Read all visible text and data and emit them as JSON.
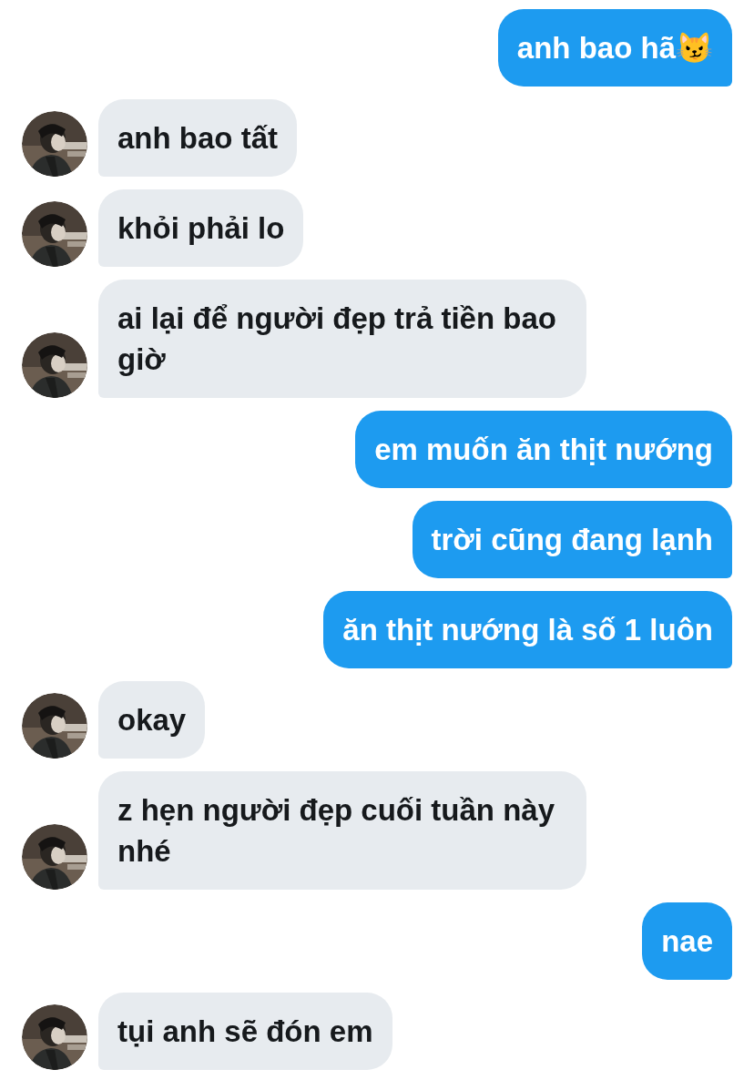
{
  "messages": [
    {
      "kind": "sent",
      "text": "anh bao hã😼"
    },
    {
      "kind": "received",
      "text": "anh bao tất"
    },
    {
      "kind": "received",
      "text": "khỏi phải lo"
    },
    {
      "kind": "received",
      "text": "ai lại để người đẹp trả tiền bao giờ"
    },
    {
      "kind": "sent",
      "text": "em muốn ăn thịt nướng"
    },
    {
      "kind": "sent",
      "text": "trời cũng đang lạnh"
    },
    {
      "kind": "sent",
      "text": "ăn thịt nướng là số 1 luôn"
    },
    {
      "kind": "received",
      "text": "okay"
    },
    {
      "kind": "received",
      "text": "z hẹn người đẹp cuối tuần này nhé"
    },
    {
      "kind": "sent",
      "text": "nae"
    },
    {
      "kind": "received",
      "text": "tụi anh sẽ đón em"
    }
  ]
}
